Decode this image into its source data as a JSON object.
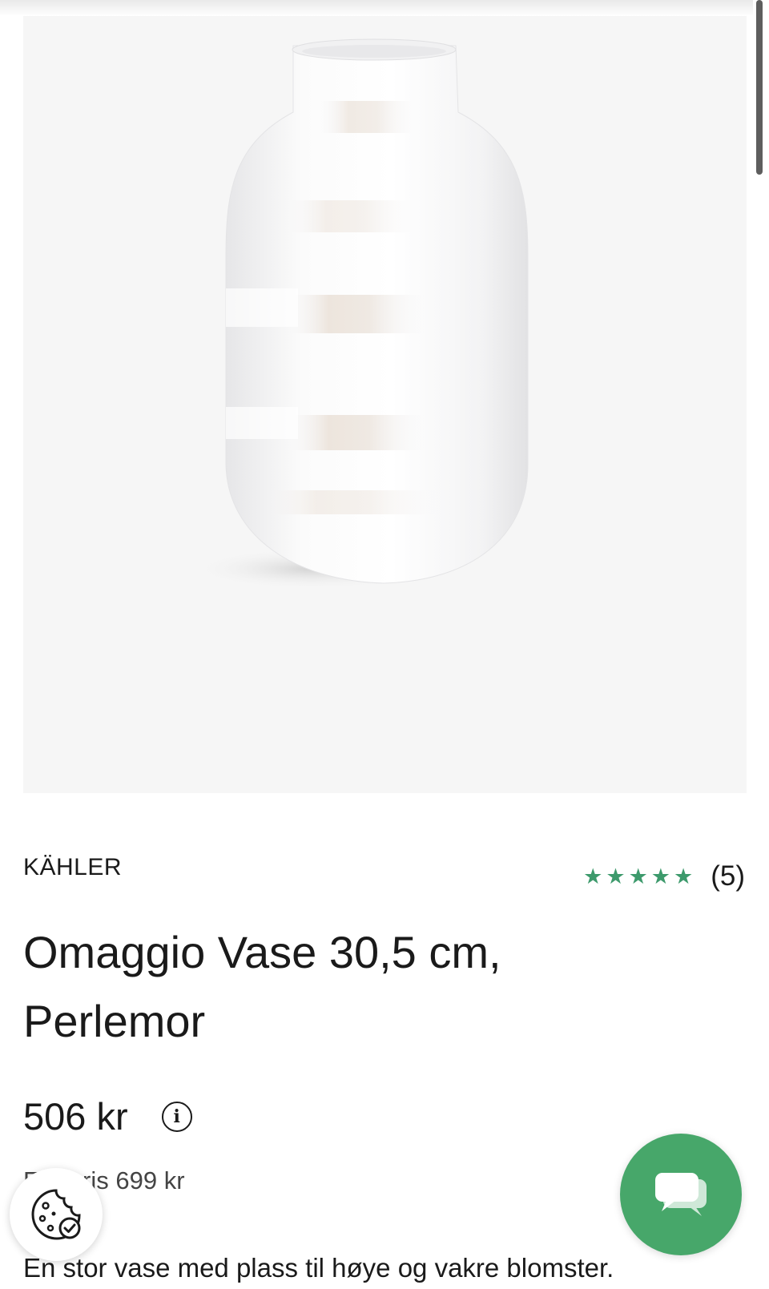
{
  "product": {
    "brand": "KÄHLER",
    "title": "Omaggio Vase 30,5 cm, Perlemor",
    "rating": 5,
    "rating_count": "(5)",
    "price": "506 kr",
    "old_price": "Før pris 699 kr",
    "description": "En stor vase med plass til høye og vakre blomster."
  },
  "icons": {
    "rating": "star-icon",
    "price_info": "info-icon",
    "cookie": "cookie-icon",
    "chat": "chat-icon"
  },
  "colors": {
    "accent_green": "#47a76a",
    "star_green": "#3d9a6c",
    "image_background": "#f6f6f6"
  }
}
